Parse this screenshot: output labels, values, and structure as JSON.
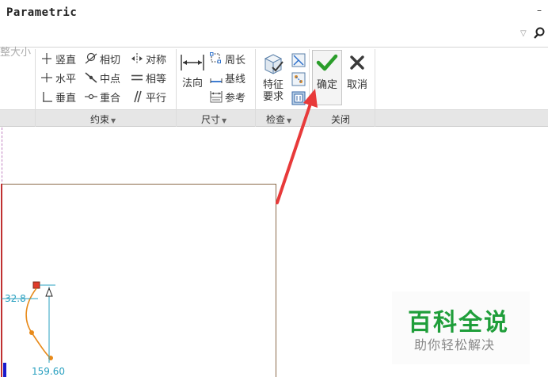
{
  "app": {
    "title": "Parametric",
    "window_minimize": "–"
  },
  "ribbon": {
    "clipped_label": "整大小",
    "constraints": {
      "group_label": "约束",
      "items": {
        "vertical": "竖直",
        "horizontal": "水平",
        "perpendicular": "垂直",
        "tangent": "相切",
        "midpoint": "中点",
        "coincident": "重合",
        "symmetric": "对称",
        "equal": "相等",
        "parallel": "平行"
      }
    },
    "dimension": {
      "group_label": "尺寸",
      "items": {
        "normal": "法向",
        "perimeter": "周长",
        "baseline": "基线",
        "reference": "参考"
      }
    },
    "inspect": {
      "group_label": "检查",
      "feature_req": [
        "特征",
        "要求"
      ]
    },
    "close": {
      "group_label": "关闭",
      "ok": "确定",
      "cancel": "取消"
    }
  },
  "canvas": {
    "dim_radius": "32.8",
    "dim_length": "159.60"
  },
  "watermark": {
    "title": "百科全说",
    "subtitle": "助你轻松解决"
  },
  "colors": {
    "accent_check": "#2a9d2a",
    "arrow": "#e83a3a",
    "watermark_green": "#1f9e3a"
  }
}
